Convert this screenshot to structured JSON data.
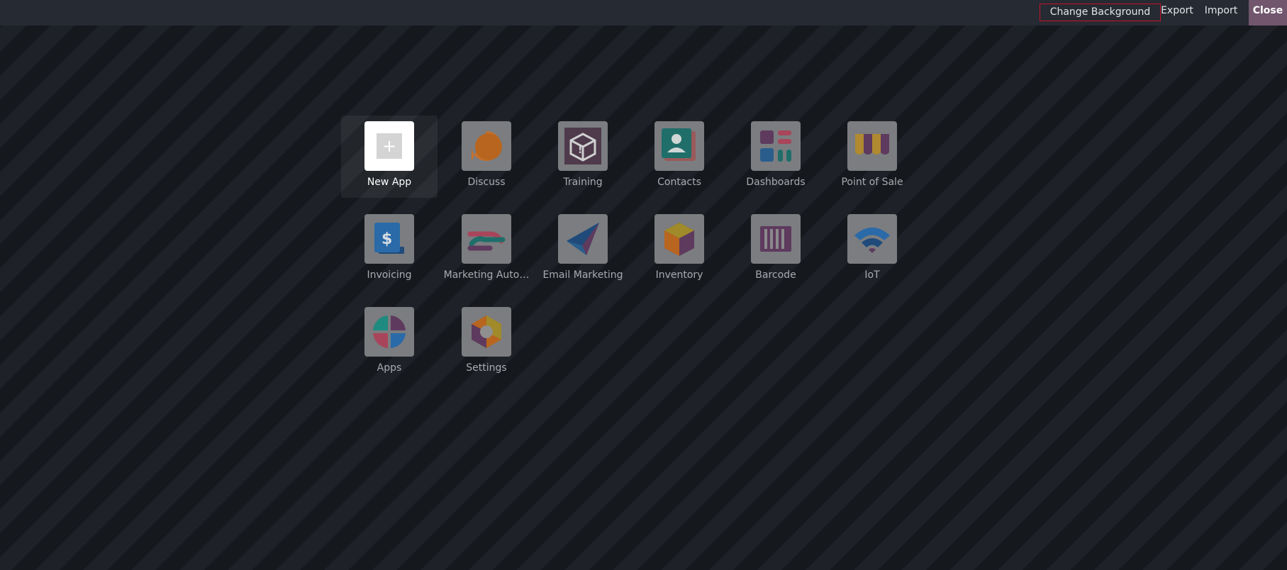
{
  "toolbar": {
    "change_background": "Change Background",
    "export": "Export",
    "import": "Import",
    "close": "Close"
  },
  "apps": [
    {
      "label": "New App",
      "icon": "plus-icon"
    },
    {
      "label": "Discuss",
      "icon": "discuss-icon"
    },
    {
      "label": "Training",
      "icon": "training-icon"
    },
    {
      "label": "Contacts",
      "icon": "contacts-icon"
    },
    {
      "label": "Dashboards",
      "icon": "dashboards-icon"
    },
    {
      "label": "Point of Sale",
      "icon": "point-of-sale-icon"
    },
    {
      "label": "Invoicing",
      "icon": "invoicing-icon"
    },
    {
      "label": "Marketing Auto…",
      "icon": "marketing-automation-icon"
    },
    {
      "label": "Email Marketing",
      "icon": "email-marketing-icon"
    },
    {
      "label": "Inventory",
      "icon": "inventory-icon"
    },
    {
      "label": "Barcode",
      "icon": "barcode-icon"
    },
    {
      "label": "IoT",
      "icon": "iot-icon"
    },
    {
      "label": "Apps",
      "icon": "apps-icon"
    },
    {
      "label": "Settings",
      "icon": "settings-icon"
    }
  ],
  "colors": {
    "topbar": "#262a32",
    "close_button": "#71566d",
    "highlight_border": "#c3142a"
  }
}
